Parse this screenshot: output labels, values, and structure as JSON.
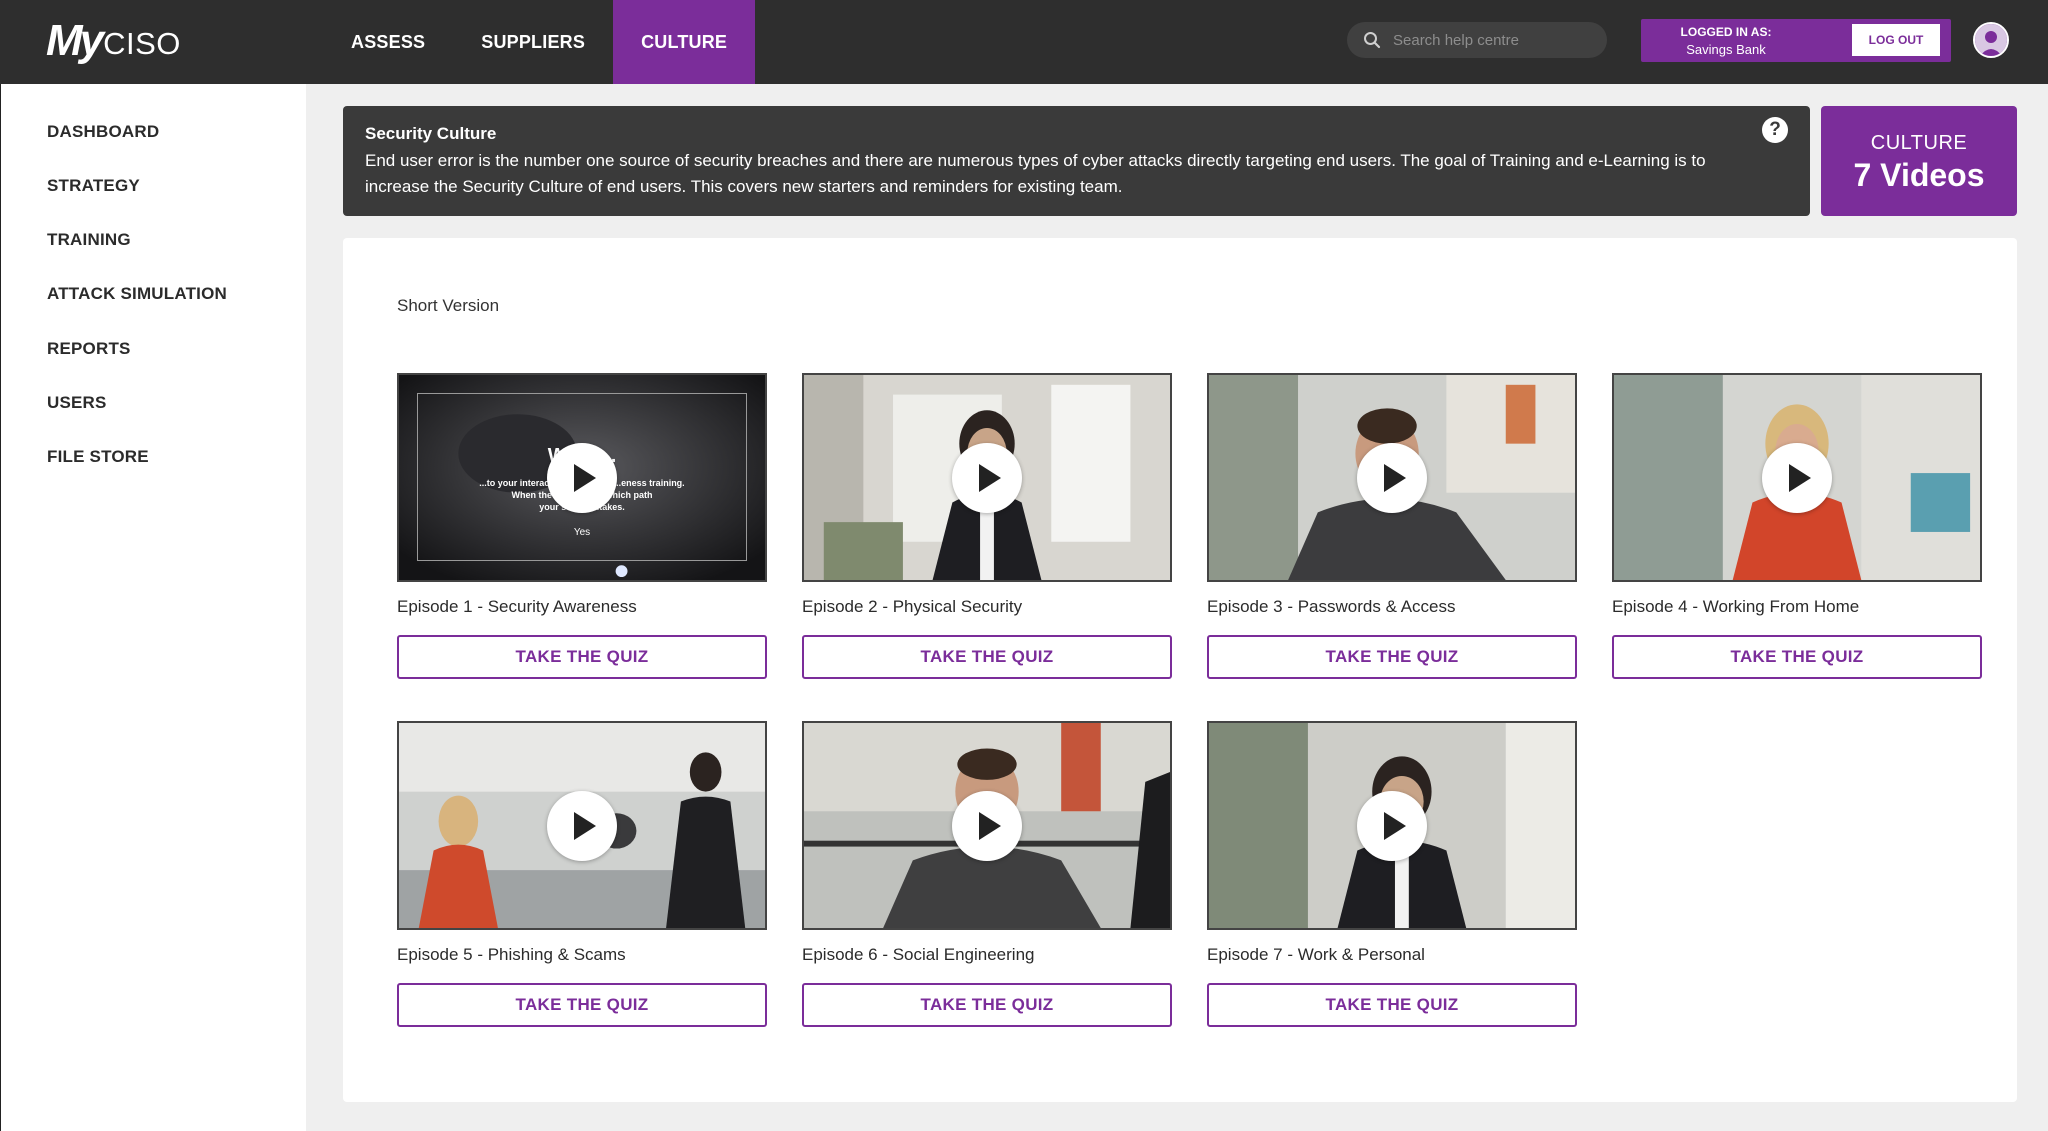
{
  "brand": {
    "logo_my": "My",
    "logo_ciso": "CISO"
  },
  "nav": {
    "items": [
      {
        "label": "ASSESS",
        "active": false
      },
      {
        "label": "SUPPLIERS",
        "active": false
      },
      {
        "label": "CULTURE",
        "active": true
      }
    ]
  },
  "search": {
    "placeholder": "Search help centre"
  },
  "account": {
    "logged_in_label": "LOGGED IN AS:",
    "org_name": "Savings Bank",
    "logout_label": "LOG OUT"
  },
  "sidebar": {
    "items": [
      {
        "label": "DASHBOARD"
      },
      {
        "label": "STRATEGY"
      },
      {
        "label": "TRAINING"
      },
      {
        "label": "ATTACK SIMULATION"
      },
      {
        "label": "REPORTS"
      },
      {
        "label": "USERS"
      },
      {
        "label": "FILE STORE"
      }
    ]
  },
  "info": {
    "title": "Security Culture",
    "description": "End user error is the number one source of security breaches and there are numerous types of cyber attacks directly targeting end users. The goal of Training and e-Learning is to increase the Security Culture of end users. This covers new starters and reminders for existing team.",
    "help_label": "?"
  },
  "counter": {
    "title": "CULTURE",
    "value": "7 Videos"
  },
  "section_title": "Short Version",
  "quiz_label": "TAKE THE QUIZ",
  "episode1_frame": {
    "headline": "We... ...",
    "line1": "...to your interact... ...security... ...eness training.",
    "line2": "When the boxes... ...k which path",
    "line3": "your secu... ...takes.",
    "yes": "Yes"
  },
  "episodes": [
    {
      "title": "Episode 1 - Security Awareness"
    },
    {
      "title": "Episode 2 - Physical Security"
    },
    {
      "title": "Episode 3 - Passwords & Access"
    },
    {
      "title": "Episode 4 - Working From Home"
    },
    {
      "title": "Episode 5 - Phishing & Scams"
    },
    {
      "title": "Episode 6 - Social Engineering"
    },
    {
      "title": "Episode 7 - Work & Personal"
    }
  ],
  "colors": {
    "accent": "#7b2d9a",
    "topbar": "#2e2e2e",
    "banner": "#3a3a3a"
  }
}
